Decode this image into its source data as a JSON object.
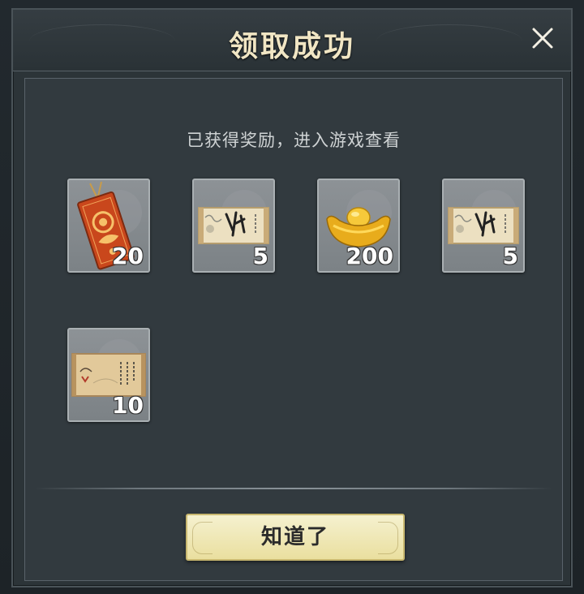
{
  "dialog": {
    "title": "领取成功",
    "subtitle": "已获得奖励，进入游戏查看",
    "confirm_label": "知道了",
    "close_icon": "close-icon"
  },
  "rewards": [
    {
      "name": "red-tag-item",
      "icon": "red-tag-icon",
      "count": "20"
    },
    {
      "name": "calligraphy-scroll-item",
      "icon": "scroll-icon",
      "count": "5"
    },
    {
      "name": "gold-ingot-item",
      "icon": "gold-ingot-icon",
      "count": "200"
    },
    {
      "name": "calligraphy-scroll-item",
      "icon": "scroll-icon",
      "count": "5"
    },
    {
      "name": "painting-scroll-item",
      "icon": "painting-scroll-icon",
      "count": "10"
    }
  ],
  "colors": {
    "title": "#f1e6c4",
    "button_bg": "#eadf9f",
    "panel_bg": "#323a3f"
  }
}
